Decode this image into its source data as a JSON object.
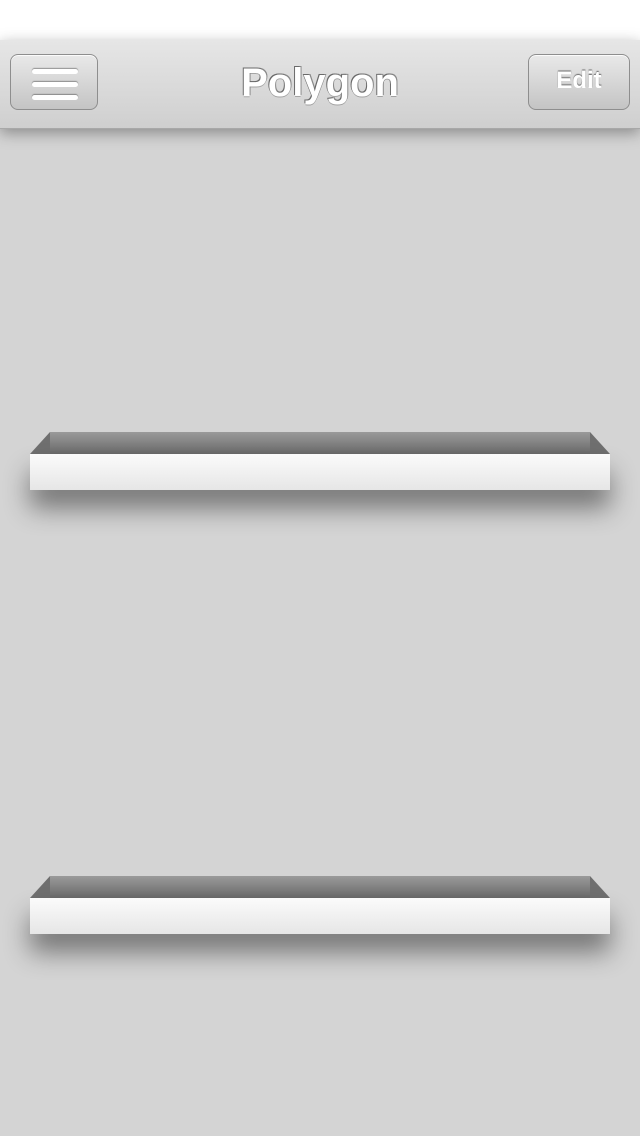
{
  "nav": {
    "title": "Polygon",
    "menu_icon": "hamburger-menu-icon",
    "edit_label": "Edit"
  },
  "shelves": [
    {
      "items": []
    },
    {
      "items": []
    }
  ],
  "colors": {
    "background": "#d4d4d4",
    "nav_bar": "#dcdcdc",
    "shelf_front": "#f2f2f2",
    "shelf_top": "#7a7a7a"
  }
}
